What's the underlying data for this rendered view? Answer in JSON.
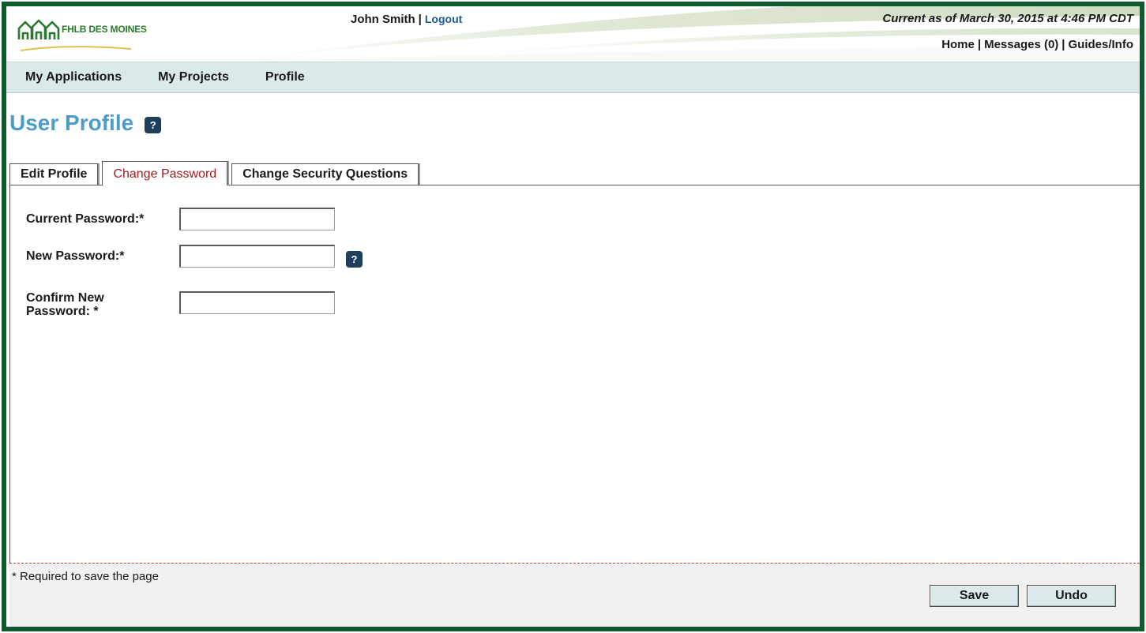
{
  "brand": {
    "name": "FHLB DES MOINES"
  },
  "header": {
    "user_name": "John Smith",
    "separator": "|",
    "logout_label": "Logout",
    "as_of": "Current as of March 30, 2015 at 4:46 PM CDT",
    "links": {
      "home": "Home",
      "messages": "Messages (0)",
      "guides": "Guides/Info"
    }
  },
  "nav": {
    "applications": "My Applications",
    "projects": "My Projects",
    "profile": "Profile"
  },
  "page": {
    "title": "User Profile",
    "help_glyph": "?"
  },
  "tabs": {
    "edit_profile": "Edit Profile",
    "change_password": "Change Password",
    "security_questions": "Change Security Questions",
    "active": "Change Password"
  },
  "form": {
    "current_password": {
      "label": "Current Password:*",
      "value": ""
    },
    "new_password": {
      "label": "New Password:*",
      "value": ""
    },
    "confirm_password": {
      "label_line1": "Confirm New",
      "label_line2": "Password: *",
      "value": ""
    }
  },
  "footer": {
    "required_note": "* Required to save the page",
    "save_label": "Save",
    "undo_label": "Undo"
  },
  "colors": {
    "frame": "#0f5a2c",
    "title": "#4d9cc8",
    "nav_bg": "#dce9ea",
    "active_tab_text": "#a31c1c",
    "help_icon_bg": "#1d3f5c",
    "dashed_divider": "#c8393a",
    "logo_green": "#2a7a2e"
  },
  "icons": {
    "page_help": "question-mark-icon",
    "new_password_help": "question-mark-icon",
    "logo": "houses-logo-icon"
  }
}
